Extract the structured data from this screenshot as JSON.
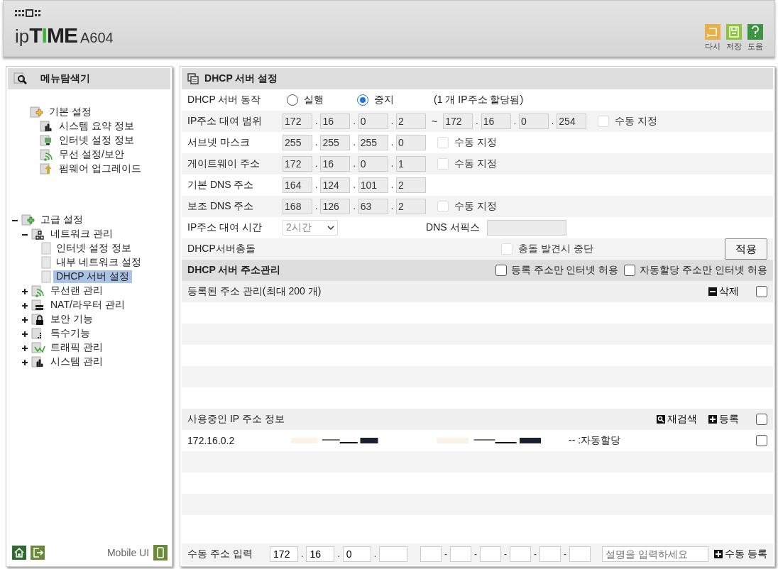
{
  "header": {
    "brand_prefix": "ip",
    "brand_mark": "TIME",
    "model": "A604",
    "tools": [
      {
        "label": "다시",
        "kind": "undo",
        "color": "#e8b04a"
      },
      {
        "label": "저장",
        "kind": "save",
        "color": "#8cc43c"
      },
      {
        "label": "도움",
        "kind": "help",
        "color": "#3c9440"
      }
    ]
  },
  "sidebar": {
    "title": "메뉴탐색기",
    "tree": [
      {
        "label": "기본 설정",
        "kind": "pinned",
        "children": [
          {
            "label": "시스템 요약 정보",
            "kind": "chart",
            "selected": false
          },
          {
            "label": "인터넷 설정 정보",
            "kind": "monitor",
            "selected": false
          },
          {
            "label": "무선 설정/보안",
            "kind": "wifi",
            "selected": false
          },
          {
            "label": "펌웨어 업그레이드",
            "kind": "upload",
            "selected": false
          }
        ]
      },
      {
        "label": "고급 설정",
        "kind": "collapsible",
        "expanded": true,
        "children": [
          {
            "label": "네트워크 관리",
            "kind": "network",
            "expanded": true,
            "children": [
              {
                "label": "인터넷 설정 정보",
                "kind": "page",
                "selected": false
              },
              {
                "label": "내부 네트워크 설정",
                "kind": "page",
                "selected": false
              },
              {
                "label": "DHCP 서버 설정",
                "kind": "page",
                "selected": true
              }
            ]
          },
          {
            "label": "무선랜 관리",
            "kind": "wifi",
            "expanded": false
          },
          {
            "label": "NAT/라우터 관리",
            "kind": "router",
            "expanded": false
          },
          {
            "label": "보안 기능",
            "kind": "lock",
            "expanded": false
          },
          {
            "label": "특수기능",
            "kind": "dots",
            "expanded": false
          },
          {
            "label": "트래픽 관리",
            "kind": "traffic",
            "expanded": false
          },
          {
            "label": "시스템 관리",
            "kind": "chart",
            "expanded": false
          }
        ]
      }
    ],
    "mobile_label": "Mobile UI"
  },
  "ip_separator": ".",
  "mac_separator": "-",
  "settings": {
    "title": "DHCP 서버 설정",
    "rows": [
      {
        "kind": "radio",
        "label": "DHCP 서버 동작",
        "options": [
          {
            "label": "실행",
            "selected": false
          },
          {
            "label": "중지",
            "selected": true
          }
        ],
        "note": "(1 개 IP주소 할당됨)"
      },
      {
        "kind": "range",
        "label": "IP주소 대여 범위",
        "disabled": true,
        "from": [
          "172",
          "16",
          "0",
          "2"
        ],
        "separator": "~",
        "to": [
          "172",
          "16",
          "0",
          "254"
        ],
        "manual": {
          "label": "수동 지정",
          "checked": false,
          "disabled": true
        }
      },
      {
        "kind": "ip",
        "label": "서브넷 마스크",
        "disabled": true,
        "ip": [
          "255",
          "255",
          "255",
          "0"
        ],
        "manual": {
          "label": "수동 지정",
          "checked": false,
          "disabled": true
        }
      },
      {
        "kind": "ip",
        "label": "게이트웨이 주소",
        "disabled": true,
        "ip": [
          "172",
          "16",
          "0",
          "1"
        ],
        "manual": {
          "label": "수동 지정",
          "checked": false,
          "disabled": true
        }
      },
      {
        "kind": "ip",
        "label": "기본 DNS 주소",
        "disabled": true,
        "ip": [
          "164",
          "124",
          "101",
          "2"
        ]
      },
      {
        "kind": "ip",
        "label": "보조 DNS 주소",
        "disabled": true,
        "ip": [
          "168",
          "126",
          "63",
          "2"
        ],
        "manual": {
          "label": "수동 지정",
          "checked": false,
          "disabled": true
        }
      },
      {
        "kind": "lease",
        "label": "IP주소 대여 시간",
        "value": "2시간",
        "disabled": true,
        "suffix_label": "DNS 서픽스"
      },
      {
        "kind": "conflict",
        "label": "DHCP서버충돌",
        "option": {
          "label": "충돌 발견시 중단",
          "checked": false,
          "disabled": true
        },
        "button": "적용"
      }
    ]
  },
  "address_management": {
    "title": "DHCP 서버 주소관리",
    "options": [
      {
        "label": "등록 주소만 인터넷 허용",
        "checked": false
      },
      {
        "label": "자동할당 주소만 인터넷 허용",
        "checked": false
      }
    ],
    "registered": {
      "title": "등록된 주소 관리(최대 200 개)",
      "actions": [
        {
          "label": "삭제",
          "kind": "minus"
        }
      ],
      "checked": false
    },
    "in_use": {
      "title": "사용중인 IP 주소 정보",
      "actions": [
        {
          "label": "재검색",
          "kind": "search"
        },
        {
          "label": "등록",
          "kind": "plus"
        }
      ],
      "checked": false,
      "rows": [
        {
          "ip": "172.16.0.2",
          "status": "-- :자동할당",
          "checked": false
        }
      ]
    },
    "manual_entry": {
      "label": "수동 주소 입력",
      "ip": [
        "172",
        "16",
        "0"
      ],
      "placeholder": "설명을 입력하세요",
      "button": "수동 등록"
    }
  }
}
